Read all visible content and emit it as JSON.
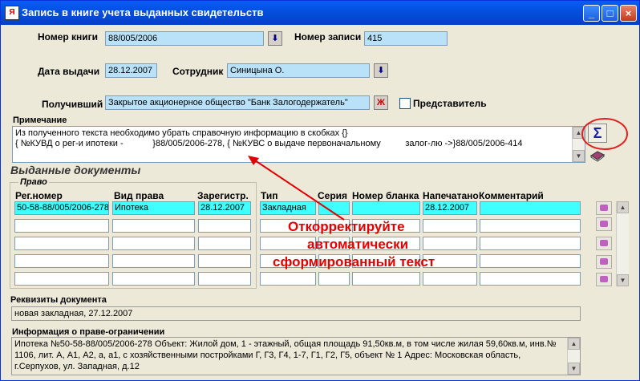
{
  "window": {
    "title": "Запись в книге учета выданных свидетельств"
  },
  "header": {
    "book_label": "Номер книги",
    "book_value": "88/005/2006",
    "record_label": "Номер записи",
    "record_value": "415",
    "date_label": "Дата выдачи",
    "date_value": "28.12.2007",
    "employee_label": "Сотрудник",
    "employee_value": "Синицына О.",
    "recipient_label": "Получивший",
    "recipient_value": "Закрытое акционерное общество \"Банк Залогодержатель\"",
    "representative_label": "Представитель"
  },
  "note": {
    "label": "Примечание",
    "line1": "Из полученного текста необходимо убрать справочную информацию в скобках {}",
    "line2": "{ №КУВД о рег-и ипотеки -            }88/005/2006-278, { №КУВС о выдаче первоначальному          залог-лю ->}88/005/2006-414",
    "sigma_symbol": "Σ"
  },
  "issued": {
    "title": "Выданные документы",
    "right_group": "Право",
    "columns": [
      "Рег.номер",
      "Вид права",
      "Зарегистр.",
      "Тип",
      "Серия",
      "Номер бланка",
      "Напечатано",
      "Комментарий"
    ],
    "row1": [
      "50-58-88/005/2006-278",
      "Ипотека",
      "28.12.2007",
      "Закладная",
      "",
      "",
      "28.12.2007",
      ""
    ]
  },
  "annotation": {
    "line1": "Откорректируйте",
    "line2": "автоматически",
    "line3": "сформированный текст"
  },
  "requisites": {
    "label": "Реквизиты документа",
    "value": "новая закладная, 27.12.2007"
  },
  "info": {
    "label": "Информация о праве-ограничении",
    "line1": "Ипотека №50-58-88/005/2006-278 Объект: Жилой дом, 1 - этажный, общая площадь 91,50кв.м, в том числе жилая 59,60кв.м, инв.№",
    "line2": "1106, лит. А, А1, А2, а, а1, с хозяйственными постройками Г, Г3, Г4, 1-7, Г1, Г2, Г5, объект № 1 Адрес: Московская область,",
    "line3": "г.Серпухов, ул. Западная, д.12"
  },
  "colors": {
    "accent_blue": "#b9e2f9",
    "selected_row": "#3fffff",
    "annotation_red": "#e00000"
  }
}
